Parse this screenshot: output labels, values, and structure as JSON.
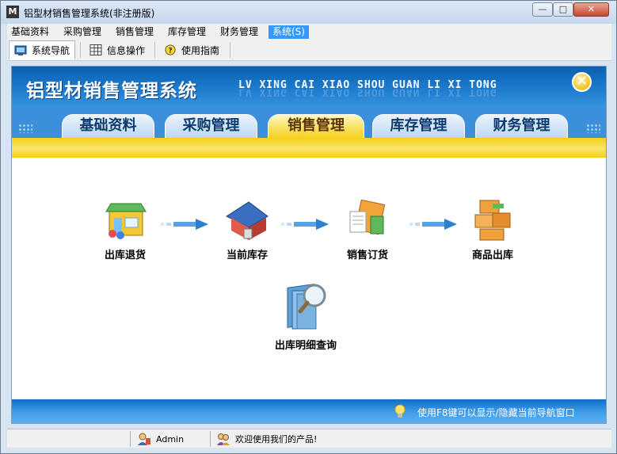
{
  "window": {
    "title": "铝型材销售管理系统(非注册版)",
    "app_icon": "app-logo-icon",
    "controls": {
      "minimize": "—",
      "maximize": "□",
      "close": "✕"
    }
  },
  "menu": [
    {
      "label": "基础资料"
    },
    {
      "label": "采购管理"
    },
    {
      "label": "销售管理"
    },
    {
      "label": "库存管理"
    },
    {
      "label": "财务管理"
    },
    {
      "label": "系统(S)"
    }
  ],
  "toolbar": [
    {
      "label": "系统导航",
      "icon": "monitor-icon"
    },
    {
      "label": "信息操作",
      "icon": "grid-icon"
    },
    {
      "label": "使用指南",
      "icon": "help-icon"
    }
  ],
  "banner": {
    "title": "铝型材销售管理系统",
    "subtitle": "LV XING CAI XIAO SHOU GUAN LI XI TONG",
    "close_symbol": "✕"
  },
  "tabs": [
    {
      "label": "基础资料"
    },
    {
      "label": "采购管理"
    },
    {
      "label": "销售管理"
    },
    {
      "label": "库存管理"
    },
    {
      "label": "财务管理"
    }
  ],
  "flow": [
    {
      "label": "出库退货",
      "icon": "store-icon"
    },
    {
      "label": "当前库存",
      "icon": "warehouse-icon"
    },
    {
      "label": "销售订货",
      "icon": "order-folder-icon"
    },
    {
      "label": "商品出库",
      "icon": "boxes-icon"
    },
    {
      "label": "出库明细查询",
      "icon": "search-folder-icon"
    }
  ],
  "footer": {
    "hint": "使用F8键可以显示/隐藏当前导航窗口"
  },
  "status": {
    "user": "Admin",
    "message": "欢迎使用我们的产品!"
  },
  "colors": {
    "banner_blue": "#1f7fd2",
    "tab_active": "#f5d020",
    "yellow_bar": "#f4d01a",
    "menu_active": "#3399ff"
  }
}
